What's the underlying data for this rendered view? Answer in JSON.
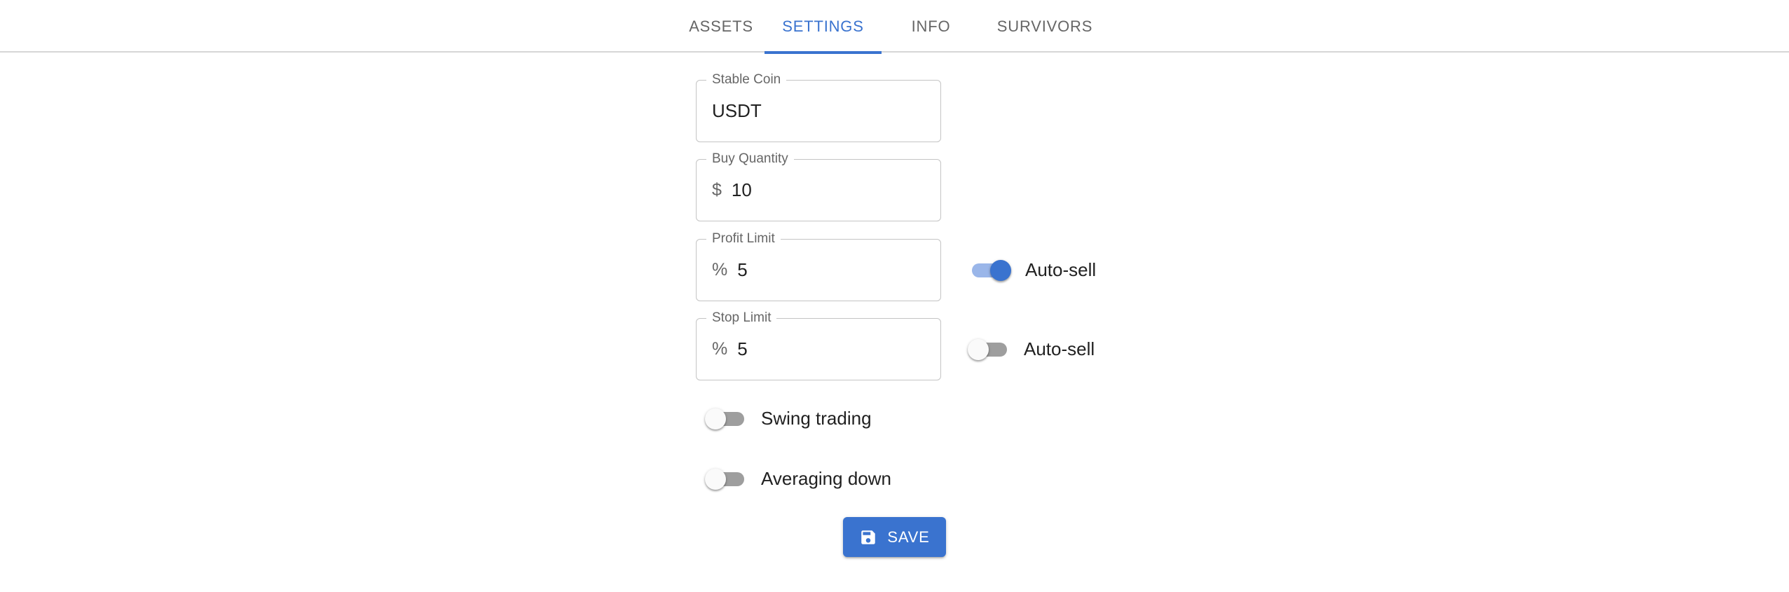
{
  "tabs": [
    {
      "label": "ASSETS",
      "active": false
    },
    {
      "label": "SETTINGS",
      "active": true
    },
    {
      "label": "INFO",
      "active": false
    },
    {
      "label": "SURVIVORS",
      "active": false
    }
  ],
  "fields": {
    "stable_coin": {
      "label": "Stable Coin",
      "value": "USDT"
    },
    "buy_quantity": {
      "label": "Buy Quantity",
      "prefix": "$",
      "value": "10"
    },
    "profit_limit": {
      "label": "Profit Limit",
      "prefix": "%",
      "value": "5"
    },
    "stop_limit": {
      "label": "Stop Limit",
      "prefix": "%",
      "value": "5"
    }
  },
  "switches": {
    "profit_autosell": {
      "label": "Auto-sell",
      "checked": true
    },
    "stop_autosell": {
      "label": "Auto-sell",
      "checked": false
    },
    "swing_trading": {
      "label": "Swing trading",
      "checked": false
    },
    "averaging_down": {
      "label": "Averaging down",
      "checked": false
    }
  },
  "save_button": {
    "label": "SAVE",
    "icon": "save-icon"
  },
  "colors": {
    "accent": "#3a73cf",
    "switch_off": "#9e9e9e",
    "border": "#c4c4c4"
  }
}
